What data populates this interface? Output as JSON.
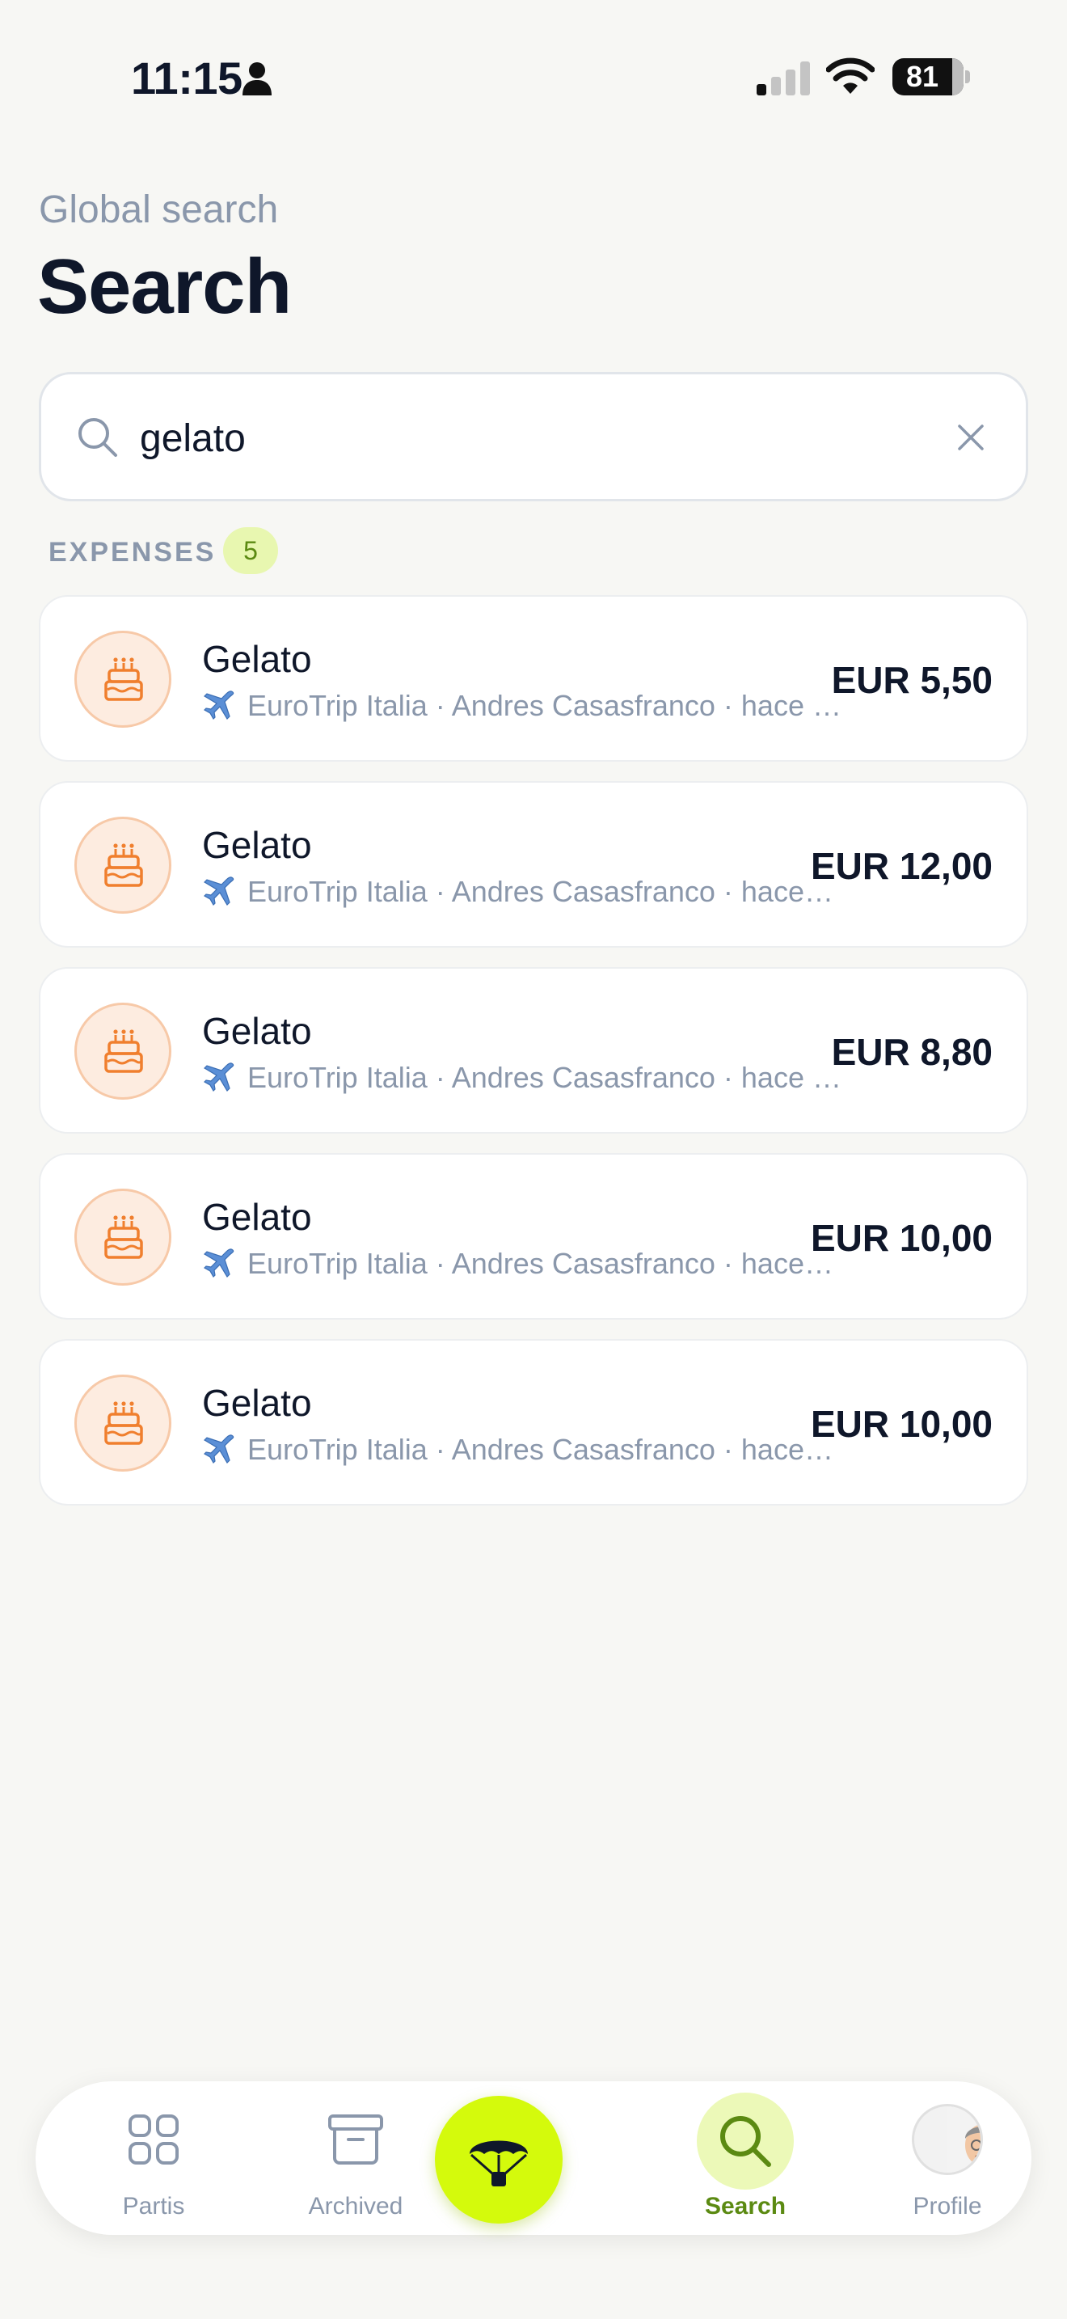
{
  "status_bar": {
    "time": "11:15",
    "battery": "81"
  },
  "header": {
    "subtitle": "Global search",
    "title": "Search"
  },
  "search": {
    "value": "gelato",
    "placeholder": ""
  },
  "section": {
    "label": "EXPENSES",
    "count": "5"
  },
  "expenses": [
    {
      "title": "Gelato",
      "meta": "EuroTrip Italia · Andres Casasfranco · hace 2…",
      "amount": "EUR 5,50",
      "icon": "cake-icon"
    },
    {
      "title": "Gelato",
      "meta": "EuroTrip Italia · Andres Casasfranco · hace…",
      "amount": "EUR 12,00",
      "icon": "cake-icon"
    },
    {
      "title": "Gelato",
      "meta": "EuroTrip Italia · Andres Casasfranco · hace 2…",
      "amount": "EUR 8,80",
      "icon": "cake-icon"
    },
    {
      "title": "Gelato",
      "meta": "EuroTrip Italia · Andres Casasfranco · hace…",
      "amount": "EUR 10,00",
      "icon": "cake-icon"
    },
    {
      "title": "Gelato",
      "meta": "EuroTrip Italia · Andres Casasfranco · hace…",
      "amount": "EUR 10,00",
      "icon": "cake-icon"
    }
  ],
  "tab_bar": {
    "tabs": [
      {
        "label": "Partis",
        "icon": "grid-icon",
        "active": false
      },
      {
        "label": "Archived",
        "icon": "archive-icon",
        "active": false
      },
      {
        "label": "",
        "icon": "parachute-icon",
        "active": false
      },
      {
        "label": "Search",
        "icon": "search-icon",
        "active": true
      },
      {
        "label": "Profile",
        "icon": "avatar",
        "active": false
      }
    ]
  },
  "colors": {
    "accent": "#d4fa0c",
    "active_tab": "#5b8a12",
    "muted_text": "#8a97ab",
    "expense_icon": "#f07f2e",
    "background": "#f7f7f4"
  }
}
